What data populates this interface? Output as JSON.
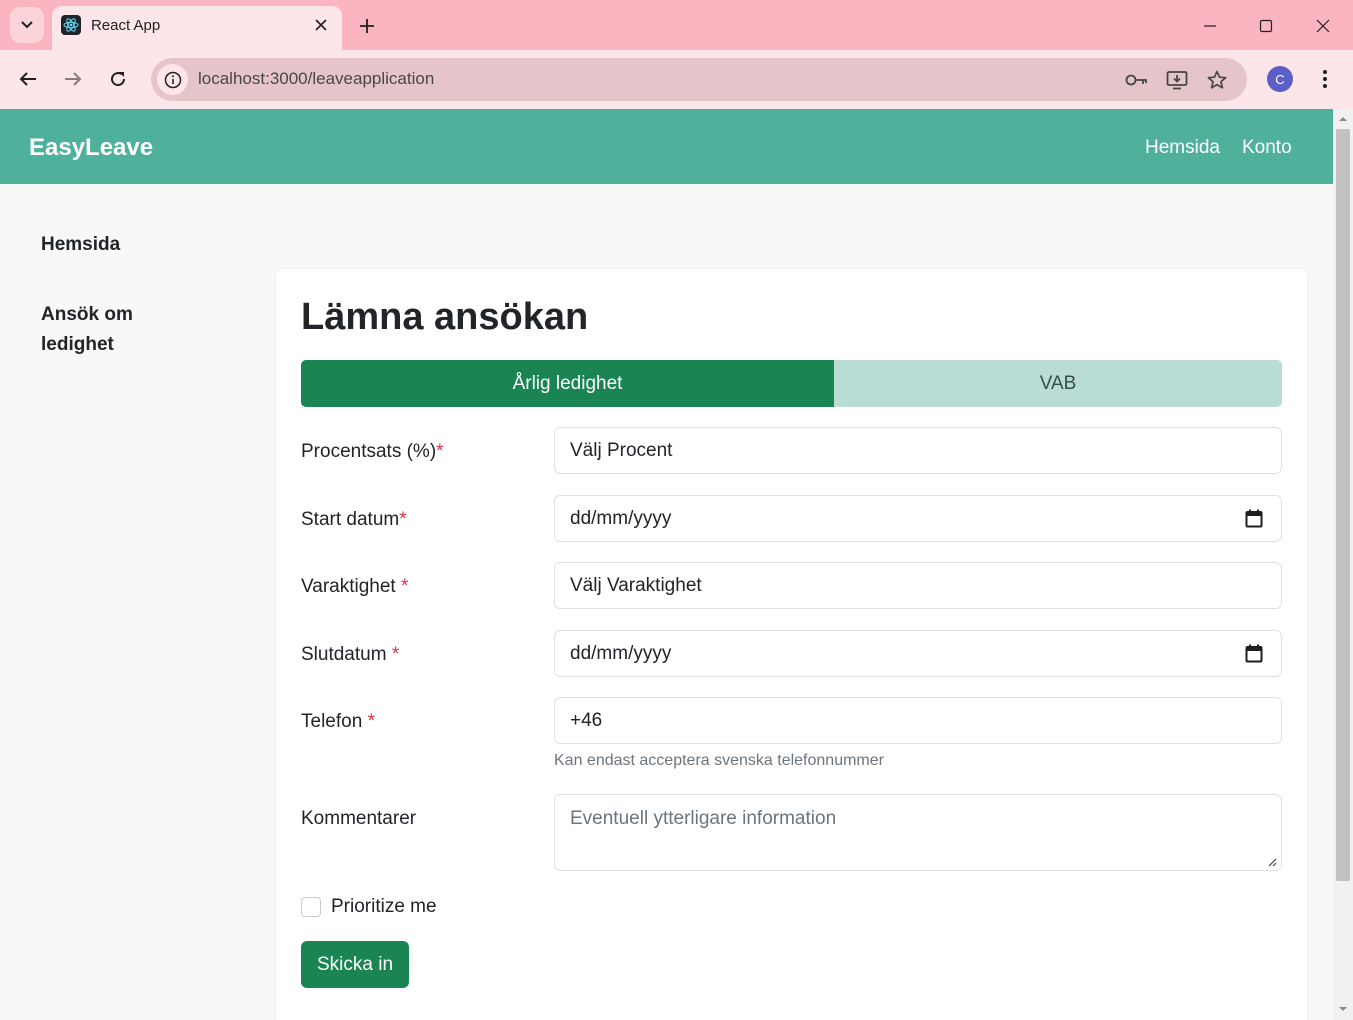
{
  "browser": {
    "tab_title": "React App",
    "url": "localhost:3000/leaveapplication",
    "profile_initial": "C"
  },
  "navbar": {
    "brand": "EasyLeave",
    "links": [
      "Hemsida",
      "Konto"
    ]
  },
  "sidebar": {
    "items": [
      {
        "label": "Hemsida"
      },
      {
        "label_line1": "Ansök om",
        "label_line2": "ledighet"
      }
    ]
  },
  "form": {
    "title": "Lämna ansökan",
    "tabs": [
      {
        "label": "Årlig ledighet",
        "active": true
      },
      {
        "label": "VAB",
        "active": false
      }
    ],
    "fields": {
      "percent": {
        "label": "Procentsats (%)",
        "required_mark": "*",
        "value": "Välj Procent"
      },
      "start_date": {
        "label": "Start datum",
        "required_mark": "*",
        "value": "dd/mm/yyyy"
      },
      "duration": {
        "label": "Varaktighet",
        "required_mark": "*",
        "value": "Välj Varaktighet"
      },
      "end_date": {
        "label": "Slutdatum",
        "required_mark": "*",
        "value": "dd/mm/yyyy"
      },
      "phone": {
        "label": "Telefon",
        "required_mark": "*",
        "value": "+46",
        "help": "Kan endast acceptera svenska telefonnummer"
      },
      "comments": {
        "label": "Kommentarer",
        "placeholder": "Eventuell ytterligare information"
      }
    },
    "priority_checkbox": {
      "label": "Prioritize me",
      "checked": false
    },
    "submit_label": "Skicka in"
  },
  "colors": {
    "navbar": "#4fb19b",
    "primary_green": "#1a8453",
    "inactive_tab": "#b9ddd4",
    "required": "#dc3545",
    "browser_frame": "#fbb5c1"
  }
}
